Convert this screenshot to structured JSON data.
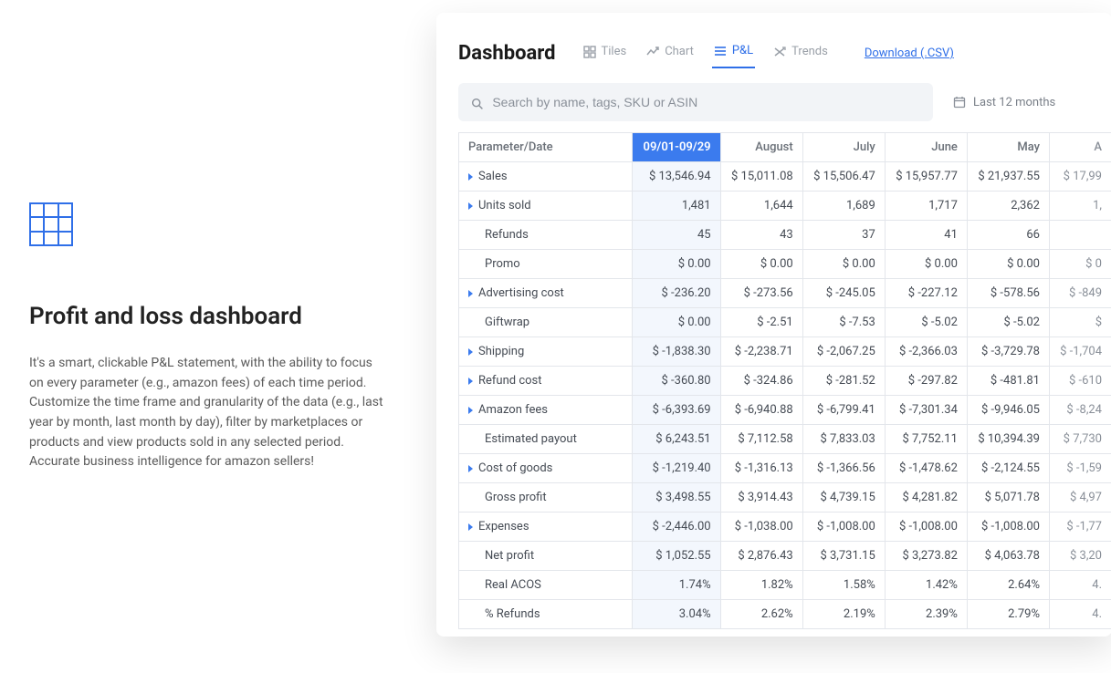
{
  "left": {
    "title": "Profit and loss dashboard",
    "desc": "It's a smart, clickable P&L statement, with the ability to focus on every parameter (e.g., amazon fees) of each time period. Customize the time frame and granularity of the data (e.g., last year by month, last month by day), filter by marketplaces or products and view products sold in any selected period. Accurate business intelligence for amazon sellers!"
  },
  "dashboard": {
    "title": "Dashboard",
    "tabs": {
      "tiles": "Tiles",
      "chart": "Chart",
      "pl": "P&L",
      "trends": "Trends"
    },
    "download_label": "Download (.CSV)",
    "search_placeholder": "Search by name, tags, SKU or ASIN",
    "date_range_label": "Last 12 months"
  },
  "table": {
    "param_header": "Parameter/Date",
    "columns": [
      "09/01-09/29",
      "August",
      "July",
      "June",
      "May",
      ""
    ],
    "partial_last": "A",
    "rows": [
      {
        "label": "Sales",
        "exp": true,
        "cells": [
          "$ 13,546.94",
          "$ 15,011.08",
          "$ 15,506.47",
          "$ 15,957.77",
          "$ 21,937.55",
          "$ 17,99"
        ]
      },
      {
        "label": "Units sold",
        "exp": true,
        "cells": [
          "1,481",
          "1,644",
          "1,689",
          "1,717",
          "2,362",
          "1,"
        ]
      },
      {
        "label": "Refunds",
        "exp": false,
        "indent": true,
        "cells": [
          "45",
          "43",
          "37",
          "41",
          "66",
          ""
        ]
      },
      {
        "label": "Promo",
        "exp": false,
        "indent": true,
        "cells": [
          "$ 0.00",
          "$ 0.00",
          "$ 0.00",
          "$ 0.00",
          "$ 0.00",
          "$ 0"
        ]
      },
      {
        "label": "Advertising cost",
        "exp": true,
        "cells": [
          "$ -236.20",
          "$ -273.56",
          "$ -245.05",
          "$ -227.12",
          "$ -578.56",
          "$ -849"
        ]
      },
      {
        "label": "Giftwrap",
        "exp": false,
        "indent": true,
        "cells": [
          "$ 0.00",
          "$ -2.51",
          "$ -7.53",
          "$ -5.02",
          "$ -5.02",
          "$ "
        ]
      },
      {
        "label": "Shipping",
        "exp": true,
        "cells": [
          "$ -1,838.30",
          "$ -2,238.71",
          "$ -2,067.25",
          "$ -2,366.03",
          "$ -3,729.78",
          "$ -1,704"
        ]
      },
      {
        "label": "Refund cost",
        "exp": true,
        "cells": [
          "$ -360.80",
          "$ -324.86",
          "$ -281.52",
          "$ -297.82",
          "$ -481.81",
          "$ -610"
        ]
      },
      {
        "label": "Amazon fees",
        "exp": true,
        "cells": [
          "$ -6,393.69",
          "$ -6,940.88",
          "$ -6,799.41",
          "$ -7,301.34",
          "$ -9,946.05",
          "$ -8,24"
        ]
      },
      {
        "label": "Estimated payout",
        "exp": false,
        "indent": true,
        "cells": [
          "$ 6,243.51",
          "$ 7,112.58",
          "$ 7,833.03",
          "$ 7,752.11",
          "$ 10,394.39",
          "$ 7,730"
        ]
      },
      {
        "label": "Cost of goods",
        "exp": true,
        "cells": [
          "$ -1,219.40",
          "$ -1,316.13",
          "$ -1,366.56",
          "$ -1,478.62",
          "$ -2,124.55",
          "$ -1,59"
        ]
      },
      {
        "label": "Gross profit",
        "exp": false,
        "indent": true,
        "cells": [
          "$ 3,498.55",
          "$ 3,914.43",
          "$ 4,739.15",
          "$ 4,281.82",
          "$ 5,071.78",
          "$ 4,97"
        ]
      },
      {
        "label": "Expenses",
        "exp": true,
        "cells": [
          "$ -2,446.00",
          "$ -1,038.00",
          "$ -1,008.00",
          "$ -1,008.00",
          "$ -1,008.00",
          "$ -1,77"
        ]
      },
      {
        "label": "Net profit",
        "exp": false,
        "indent": true,
        "cells": [
          "$ 1,052.55",
          "$ 2,876.43",
          "$ 3,731.15",
          "$ 3,273.82",
          "$ 4,063.78",
          "$ 3,20"
        ]
      },
      {
        "label": "Real ACOS",
        "exp": false,
        "indent": true,
        "cells": [
          "1.74%",
          "1.82%",
          "1.58%",
          "1.42%",
          "2.64%",
          "4."
        ]
      },
      {
        "label": "% Refunds",
        "exp": false,
        "indent": true,
        "cells": [
          "3.04%",
          "2.62%",
          "2.19%",
          "2.39%",
          "2.79%",
          "4."
        ]
      }
    ]
  }
}
